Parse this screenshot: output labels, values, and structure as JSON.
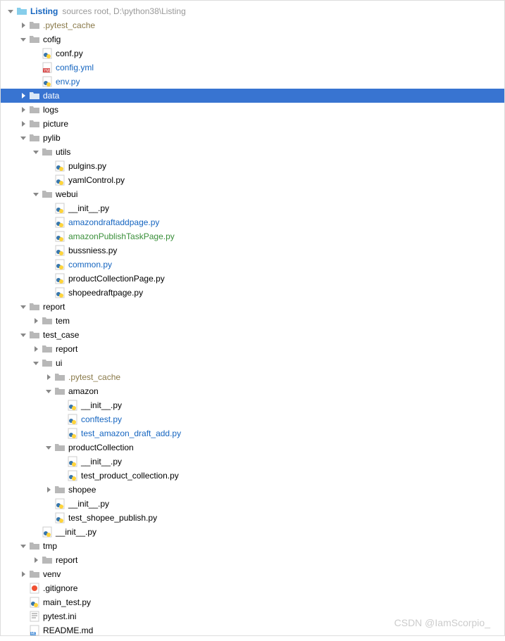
{
  "root": {
    "name": "Listing",
    "hint": "sources root,  D:\\python38\\Listing"
  },
  "tree": [
    {
      "d": 0,
      "t": "folder-root",
      "arrow": "down",
      "label": "Listing",
      "bold": true,
      "hint": "sources root,  D:\\python38\\Listing",
      "color": "link"
    },
    {
      "d": 1,
      "t": "folder",
      "arrow": "right",
      "label": ".pytest_cache",
      "color": "excluded"
    },
    {
      "d": 1,
      "t": "folder",
      "arrow": "down",
      "label": "cofig"
    },
    {
      "d": 2,
      "t": "py",
      "label": "conf.py"
    },
    {
      "d": 2,
      "t": "yml",
      "label": "config.yml",
      "color": "link"
    },
    {
      "d": 2,
      "t": "py",
      "label": "env.py",
      "color": "link"
    },
    {
      "d": 1,
      "t": "folder",
      "arrow": "right",
      "label": "data",
      "selected": true
    },
    {
      "d": 1,
      "t": "folder",
      "arrow": "right",
      "label": "logs"
    },
    {
      "d": 1,
      "t": "folder",
      "arrow": "right",
      "label": "picture"
    },
    {
      "d": 1,
      "t": "folder",
      "arrow": "down",
      "label": "pylib"
    },
    {
      "d": 2,
      "t": "folder",
      "arrow": "down",
      "label": "utils"
    },
    {
      "d": 3,
      "t": "py",
      "label": "pulgins.py"
    },
    {
      "d": 3,
      "t": "py",
      "label": "yamlControl.py"
    },
    {
      "d": 2,
      "t": "folder",
      "arrow": "down",
      "label": "webui"
    },
    {
      "d": 3,
      "t": "py",
      "label": "__init__.py"
    },
    {
      "d": 3,
      "t": "py",
      "label": "amazondraftaddpage.py",
      "color": "link"
    },
    {
      "d": 3,
      "t": "py",
      "label": "amazonPublishTaskPage.py",
      "color": "vcs-green"
    },
    {
      "d": 3,
      "t": "py",
      "label": "bussniess.py"
    },
    {
      "d": 3,
      "t": "py",
      "label": "common.py",
      "color": "link"
    },
    {
      "d": 3,
      "t": "py",
      "label": "productCollectionPage.py"
    },
    {
      "d": 3,
      "t": "py",
      "label": "shopeedraftpage.py"
    },
    {
      "d": 1,
      "t": "folder",
      "arrow": "down",
      "label": "report"
    },
    {
      "d": 2,
      "t": "folder",
      "arrow": "right",
      "label": "tem"
    },
    {
      "d": 1,
      "t": "folder",
      "arrow": "down",
      "label": "test_case"
    },
    {
      "d": 2,
      "t": "folder",
      "arrow": "right",
      "label": "report"
    },
    {
      "d": 2,
      "t": "folder",
      "arrow": "down",
      "label": "ui"
    },
    {
      "d": 3,
      "t": "folder",
      "arrow": "right",
      "label": ".pytest_cache",
      "color": "excluded"
    },
    {
      "d": 3,
      "t": "folder",
      "arrow": "down",
      "label": "amazon"
    },
    {
      "d": 4,
      "t": "py",
      "label": "__init__.py"
    },
    {
      "d": 4,
      "t": "py",
      "label": "conftest.py",
      "color": "link"
    },
    {
      "d": 4,
      "t": "py",
      "label": "test_amazon_draft_add.py",
      "color": "link"
    },
    {
      "d": 3,
      "t": "folder",
      "arrow": "down",
      "label": "productCollection"
    },
    {
      "d": 4,
      "t": "py",
      "label": "__init__.py"
    },
    {
      "d": 4,
      "t": "py",
      "label": "test_product_collection.py"
    },
    {
      "d": 3,
      "t": "folder",
      "arrow": "right",
      "label": "shopee"
    },
    {
      "d": 3,
      "t": "py",
      "label": "__init__.py"
    },
    {
      "d": 3,
      "t": "py",
      "label": "test_shopee_publish.py"
    },
    {
      "d": 2,
      "t": "py",
      "label": "__init__.py"
    },
    {
      "d": 1,
      "t": "folder",
      "arrow": "down",
      "label": "tmp"
    },
    {
      "d": 2,
      "t": "folder",
      "arrow": "right",
      "label": "report"
    },
    {
      "d": 1,
      "t": "folder",
      "arrow": "right",
      "label": "venv"
    },
    {
      "d": 1,
      "t": "git",
      "label": ".gitignore"
    },
    {
      "d": 1,
      "t": "py",
      "label": "main_test.py"
    },
    {
      "d": 1,
      "t": "txt",
      "label": "pytest.ini"
    },
    {
      "d": 1,
      "t": "md",
      "label": "README.md"
    }
  ],
  "watermark": "CSDN @IamScorpio_"
}
